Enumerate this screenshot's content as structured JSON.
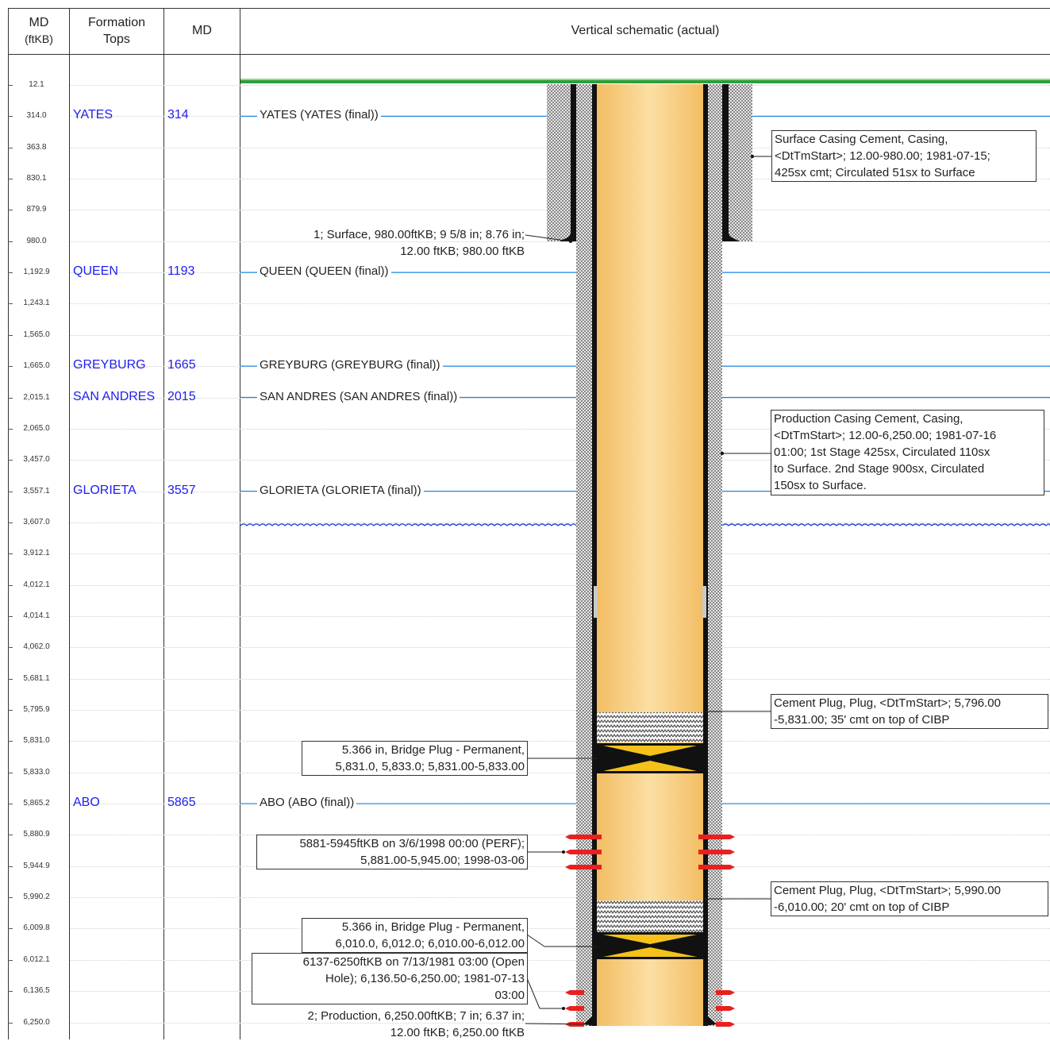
{
  "header": {
    "md_ftkb": [
      "MD",
      "(ftKB)"
    ],
    "formation_tops": [
      "Formation",
      "Tops"
    ],
    "md": "MD",
    "schematic": "Vertical schematic (actual)"
  },
  "md_rows": [
    "12.1",
    "314.0",
    "363.8",
    "830.1",
    "879.9",
    "980.0",
    "1,192.9",
    "1,243.1",
    "1,565.0",
    "1,665.0",
    "2,015.1",
    "2,065.0",
    "3,457.0",
    "3,557.1",
    "3,607.0",
    "3,912.1",
    "4,012.1",
    "4,014.1",
    "4,062.0",
    "5,681.1",
    "5,795.9",
    "5,831.0",
    "5,833.0",
    "5,865.2",
    "5,880.9",
    "5,944.9",
    "5,990.2",
    "6,009.8",
    "6,012.1",
    "6,136.5",
    "6,250.0"
  ],
  "formations": [
    {
      "name": "YATES",
      "md": "314",
      "label": "YATES (YATES (final))",
      "row": 1
    },
    {
      "name": "QUEEN",
      "md": "1193",
      "label": "QUEEN (QUEEN (final))",
      "row": 6
    },
    {
      "name": "GREYBURG",
      "md": "1665",
      "label": "GREYBURG (GREYBURG (final))",
      "row": 9
    },
    {
      "name": "SAN ANDRES",
      "md": "2015",
      "label": "SAN ANDRES (SAN ANDRES (final))",
      "row": 10
    },
    {
      "name": "GLORIETA",
      "md": "3557",
      "label": "GLORIETA (GLORIETA (final))",
      "row": 13
    },
    {
      "name": "ABO",
      "md": "5865",
      "label": "ABO (ABO (final))",
      "row": 23
    }
  ],
  "callouts": {
    "surface_cement": [
      "Surface Casing Cement, Casing,",
      "<DtTmStart>; 12.00-980.00; 1981-07-15;",
      "425sx cmt; Circulated 51sx to Surface"
    ],
    "production_cement": [
      "Production Casing Cement, Casing,",
      "<DtTmStart>; 12.00-6,250.00; 1981-07-16",
      "01:00; 1st Stage 425sx, Circulated 110sx",
      "to Surface. 2nd Stage 900sx, Circulated",
      "150sx to Surface."
    ],
    "cement_plug_1": [
      "Cement Plug, Plug, <DtTmStart>; 5,796.00",
      "-5,831.00; 35' cmt on top of CIBP"
    ],
    "cement_plug_2": [
      "Cement Plug, Plug, <DtTmStart>; 5,990.00",
      "-6,010.00; 20' cmt on top of CIBP"
    ],
    "bridge_plug_1": [
      "5.366 in, Bridge Plug - Permanent,",
      "5,831.0, 5,833.0; 5,831.00-5,833.00"
    ],
    "perf": [
      "5881-5945ftKB on 3/6/1998 00:00 (PERF);",
      "5,881.00-5,945.00; 1998-03-06"
    ],
    "bridge_plug_2": [
      "5.366 in, Bridge Plug - Permanent,",
      "6,010.0, 6,012.0; 6,010.00-6,012.00"
    ],
    "open_hole": [
      "6137-6250ftKB on 7/13/1981 03:00 (Open",
      "Hole); 6,136.50-6,250.00; 1981-07-13",
      "03:00"
    ]
  },
  "labels": {
    "surface_casing": [
      "1; Surface, 980.00ftKB; 9 5/8 in; 8.76 in;",
      "12.00 ftKB; 980.00 ftKB"
    ],
    "production_casing": [
      "2; Production, 6,250.00ftKB; 7 in; 6.37 in;",
      "12.00 ftKB; 6,250.00 ftKB"
    ]
  },
  "colors": {
    "formation_text": "#2020ee",
    "formation_line": "#1e88e5",
    "wellbore_fill": "#f8cd80",
    "ground": "#2e9e3c",
    "bridge_plug": "#f4c21b",
    "perf": "#e82020"
  }
}
